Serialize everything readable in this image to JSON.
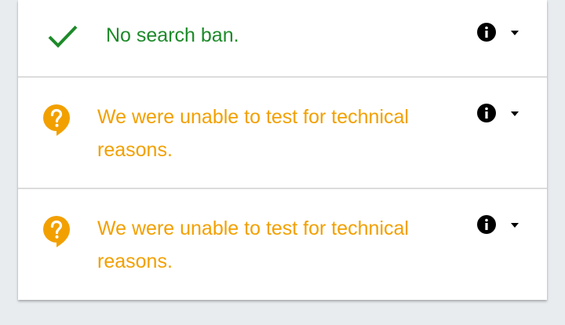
{
  "results": [
    {
      "status": "ok",
      "icon": "checkmark-icon",
      "message": "No search ban.",
      "color": "#1d8a29"
    },
    {
      "status": "unknown",
      "icon": "question-bubble-icon",
      "message": "We were unable to test for technical reasons.",
      "color": "#f2a000"
    },
    {
      "status": "unknown",
      "icon": "question-bubble-icon",
      "message": "We were unable to test for technical reasons.",
      "color": "#f2a000"
    }
  ],
  "controls": {
    "info_icon": "info-icon",
    "dropdown_icon": "caret-down-icon"
  },
  "colors": {
    "background": "#e8ecef",
    "card": "#ffffff",
    "divider": "#dcdcdc",
    "ok": "#1d8a29",
    "warning": "#f2a000",
    "icon_dark": "#000000"
  }
}
